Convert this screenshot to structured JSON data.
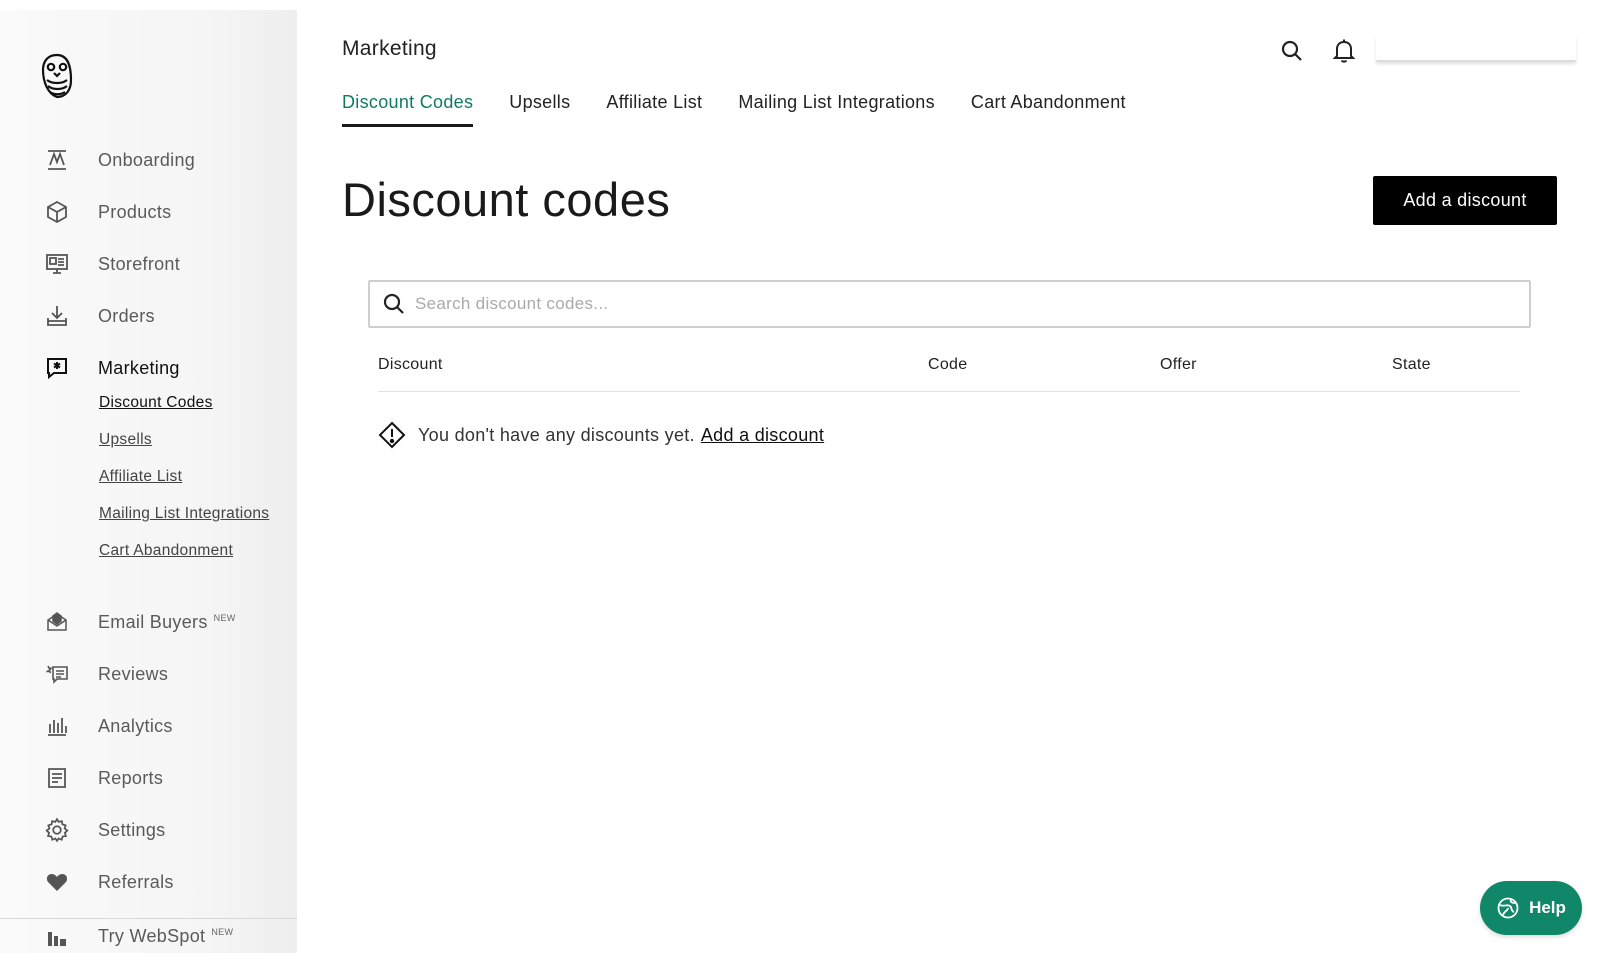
{
  "sidebar": {
    "logo_icon": "owl-logo-icon",
    "items": [
      {
        "label": "Onboarding",
        "icon": "onboarding-icon"
      },
      {
        "label": "Products",
        "icon": "box-icon"
      },
      {
        "label": "Storefront",
        "icon": "storefront-icon"
      },
      {
        "label": "Orders",
        "icon": "download-tray-icon"
      },
      {
        "label": "Marketing",
        "icon": "speech-star-icon",
        "active": true
      },
      {
        "label": "Email Buyers",
        "badge": "NEW",
        "icon": "envelope-icon"
      },
      {
        "label": "Reviews",
        "icon": "reviews-icon"
      },
      {
        "label": "Analytics",
        "icon": "bar-chart-icon"
      },
      {
        "label": "Reports",
        "icon": "report-icon"
      },
      {
        "label": "Settings",
        "icon": "gear-icon"
      },
      {
        "label": "Referrals",
        "icon": "heart-icon"
      },
      {
        "label": "Try WebSpot",
        "badge": "NEW",
        "icon": "webspot-icon"
      }
    ],
    "marketing_sub": [
      "Discount Codes",
      "Upsells",
      "Affiliate List",
      "Mailing List Integrations",
      "Cart Abandonment"
    ]
  },
  "header": {
    "section": "Marketing",
    "search_icon": "search-icon",
    "bell_icon": "bell-icon"
  },
  "tabs": [
    "Discount Codes",
    "Upsells",
    "Affiliate List",
    "Mailing List Integrations",
    "Cart Abandonment"
  ],
  "active_tab": "Discount Codes",
  "main": {
    "title": "Discount codes",
    "add_button": "Add a discount",
    "search_placeholder": "Search discount codes...",
    "columns": [
      "Discount",
      "Code",
      "Offer",
      "State"
    ],
    "empty_text": "You don't have any discounts yet.",
    "empty_link": "Add a discount"
  },
  "help": {
    "label": "Help",
    "icon": "globe-icon"
  },
  "colors": {
    "accent": "#0f7a63",
    "help_bg": "#11876a",
    "primary_button": "#000000"
  }
}
